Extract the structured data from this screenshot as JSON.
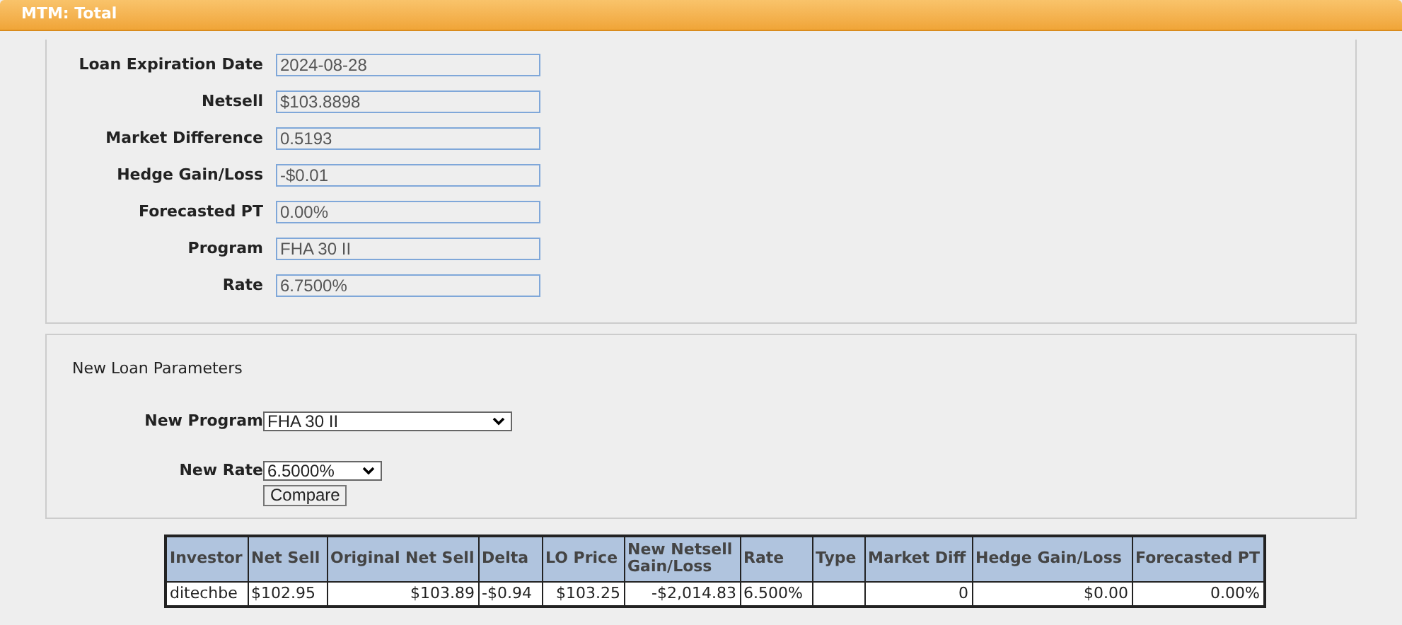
{
  "header": {
    "title": "MTM: Total"
  },
  "loan_fields": [
    {
      "label": "Loan Expiration Date",
      "value": "2024-08-28"
    },
    {
      "label": "Netsell",
      "value": "$103.8898"
    },
    {
      "label": "Market Difference",
      "value": "0.5193"
    },
    {
      "label": "Hedge Gain/Loss",
      "value": "-$0.01"
    },
    {
      "label": "Forecasted PT",
      "value": "0.00%"
    },
    {
      "label": "Program",
      "value": "FHA 30 II"
    },
    {
      "label": "Rate",
      "value": "6.7500%"
    }
  ],
  "new_loan_parameters": {
    "title": "New Loan Parameters",
    "program_label": "New Program",
    "program_value": "FHA 30 II",
    "rate_label": "New Rate",
    "rate_value": "6.5000%",
    "compare_button": "Compare"
  },
  "table": {
    "columns": [
      "Investor",
      "Net Sell",
      "Original Net Sell",
      "Delta",
      "LO Price",
      "New Netsell Gain/Loss",
      "Rate",
      "Type",
      "Market Diff",
      "Hedge Gain/Loss",
      "Forecasted PT"
    ],
    "rows": [
      [
        "ditechbe",
        "$102.95",
        "$103.89",
        "-$0.94",
        "$103.25",
        "-$2,014.83",
        "6.500%",
        "",
        "0",
        "$0.00",
        "0.00%"
      ]
    ]
  }
}
